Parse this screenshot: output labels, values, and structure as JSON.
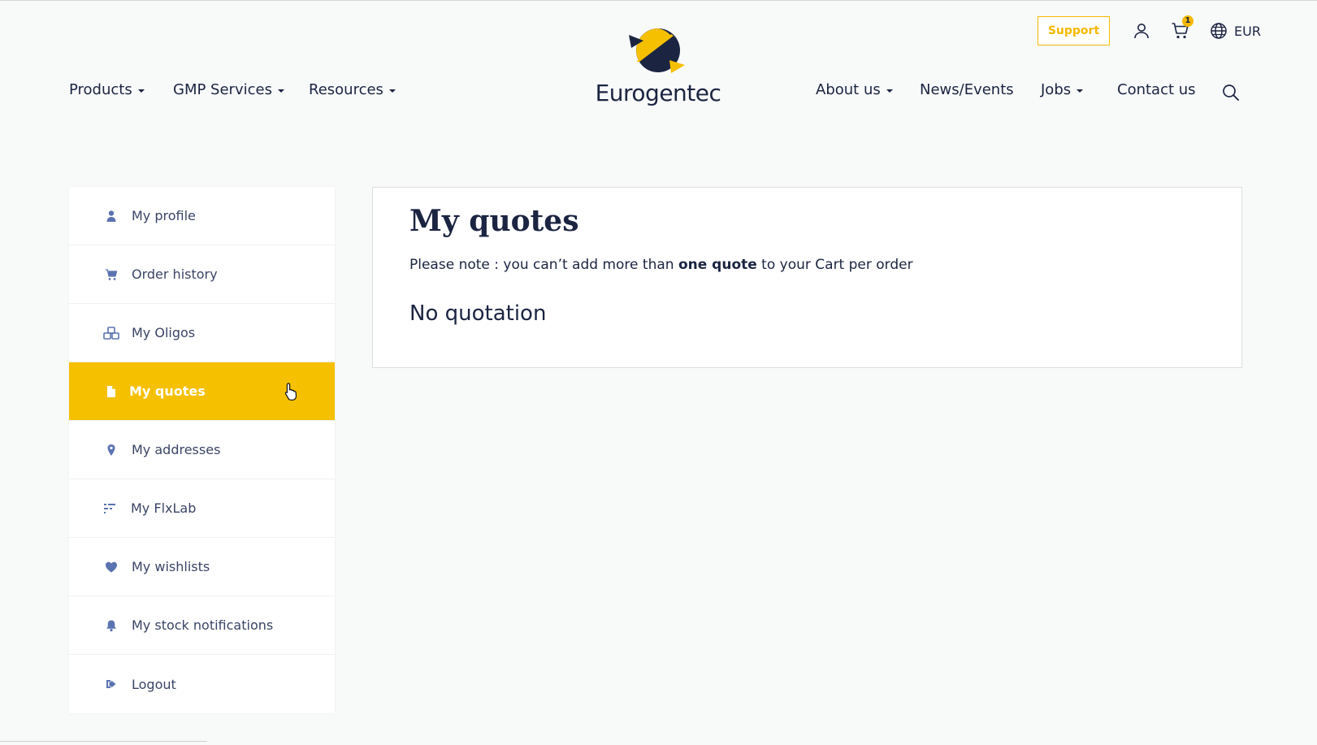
{
  "header": {
    "support_label": "Support",
    "cart_count": "1",
    "currency": "EUR",
    "logo_text": "Eurogentec",
    "nav_left": [
      {
        "label": "Products",
        "dropdown": true
      },
      {
        "label": "GMP Services",
        "dropdown": true
      },
      {
        "label": "Resources",
        "dropdown": true
      }
    ],
    "nav_right": [
      {
        "label": "About us",
        "dropdown": true
      },
      {
        "label": "News/Events",
        "dropdown": false
      },
      {
        "label": "Jobs",
        "dropdown": true
      },
      {
        "label": "Contact us",
        "dropdown": false
      }
    ]
  },
  "sidebar": {
    "items": [
      {
        "label": "My profile",
        "icon": "user-icon"
      },
      {
        "label": "Order history",
        "icon": "cart-icon"
      },
      {
        "label": "My Oligos",
        "icon": "cubes-icon"
      },
      {
        "label": "My quotes",
        "icon": "file-icon",
        "active": true
      },
      {
        "label": "My addresses",
        "icon": "map-pin-icon"
      },
      {
        "label": "My FlxLab",
        "icon": "sliders-icon"
      },
      {
        "label": "My wishlists",
        "icon": "heart-icon"
      },
      {
        "label": "My stock notifications",
        "icon": "bell-icon"
      },
      {
        "label": "Logout",
        "icon": "sign-out-icon"
      }
    ]
  },
  "main": {
    "title": "My quotes",
    "note_before": "Please note : you can’t add more than ",
    "note_bold": "one quote",
    "note_after": " to your Cart per order",
    "empty_message": "No quotation"
  },
  "colors": {
    "accent": "#f5c000",
    "navy": "#1b2441",
    "icon_blue": "#5b73b0"
  }
}
